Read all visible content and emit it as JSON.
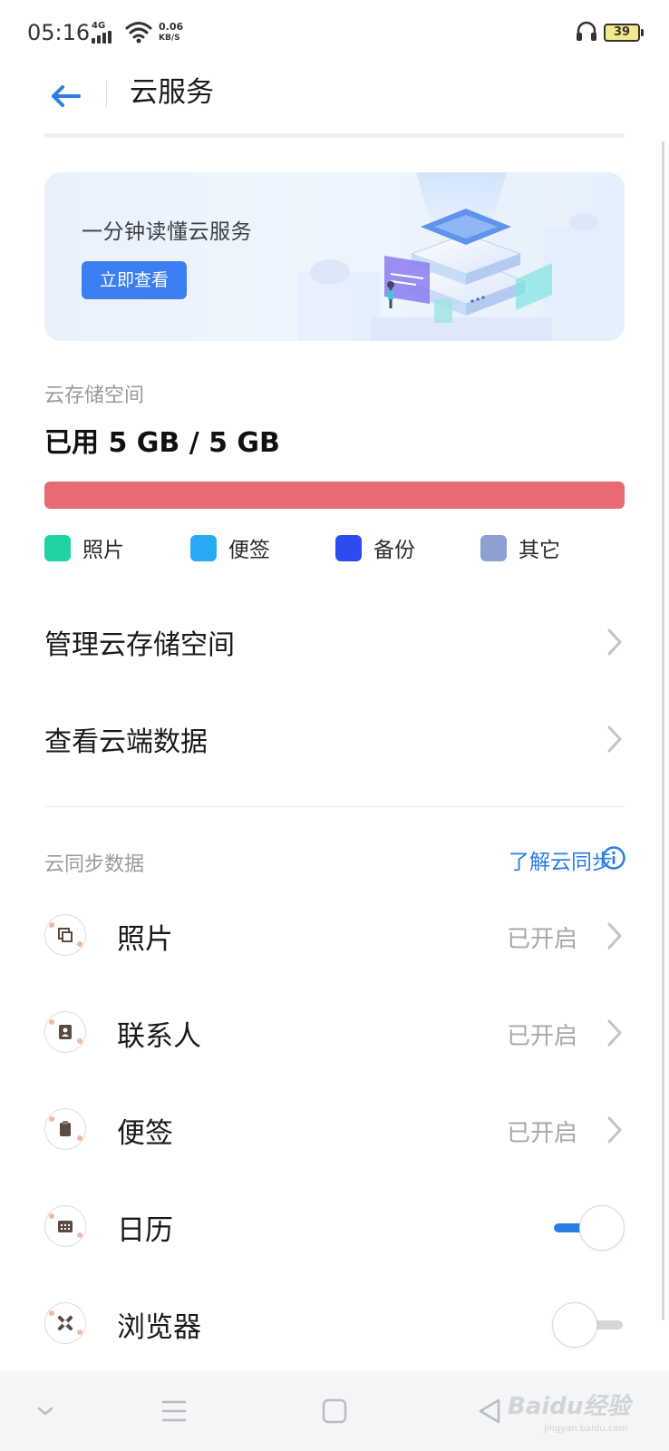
{
  "status_bar": {
    "time": "05:16",
    "network": "4G",
    "speed_value": "0.06",
    "speed_unit": "KB/S",
    "battery": "39"
  },
  "header": {
    "title": "云服务",
    "back_icon": "arrow-left-icon"
  },
  "banner": {
    "text": "一分钟读懂云服务",
    "button_label": "立即查看"
  },
  "storage": {
    "label": "云存储空间",
    "used_text": "已用 5 GB / 5 GB",
    "used_fraction": 1.0,
    "bar_color": "#e86a73",
    "legend": [
      {
        "label": "照片",
        "color": "#1ed2a4"
      },
      {
        "label": "便签",
        "color": "#27a9f4"
      },
      {
        "label": "备份",
        "color": "#2d4bf0"
      },
      {
        "label": "其它",
        "color": "#8e9fd2"
      }
    ]
  },
  "menu": {
    "manage": "管理云存储空间",
    "view": "查看云端数据"
  },
  "sync": {
    "section_label": "云同步数据",
    "learn_link": "了解云同步",
    "items": [
      {
        "name": "照片",
        "status": "已开启",
        "icon": "photos-icon"
      },
      {
        "name": "联系人",
        "status": "已开启",
        "icon": "contacts-icon"
      },
      {
        "name": "便签",
        "status": "已开启",
        "icon": "notes-icon"
      },
      {
        "name": "日历",
        "toggle": true,
        "icon": "calendar-icon"
      },
      {
        "name": "浏览器",
        "toggle": false,
        "icon": "browser-icon"
      }
    ]
  },
  "colors": {
    "accent": "#2a7ee6",
    "banner_button": "#3d7ff2",
    "toggle_on": "#2a7ee6",
    "toggle_off": "#d5d5d5"
  },
  "watermark": {
    "text": "Baidu经验",
    "sub": "jingyan.baidu.com"
  }
}
